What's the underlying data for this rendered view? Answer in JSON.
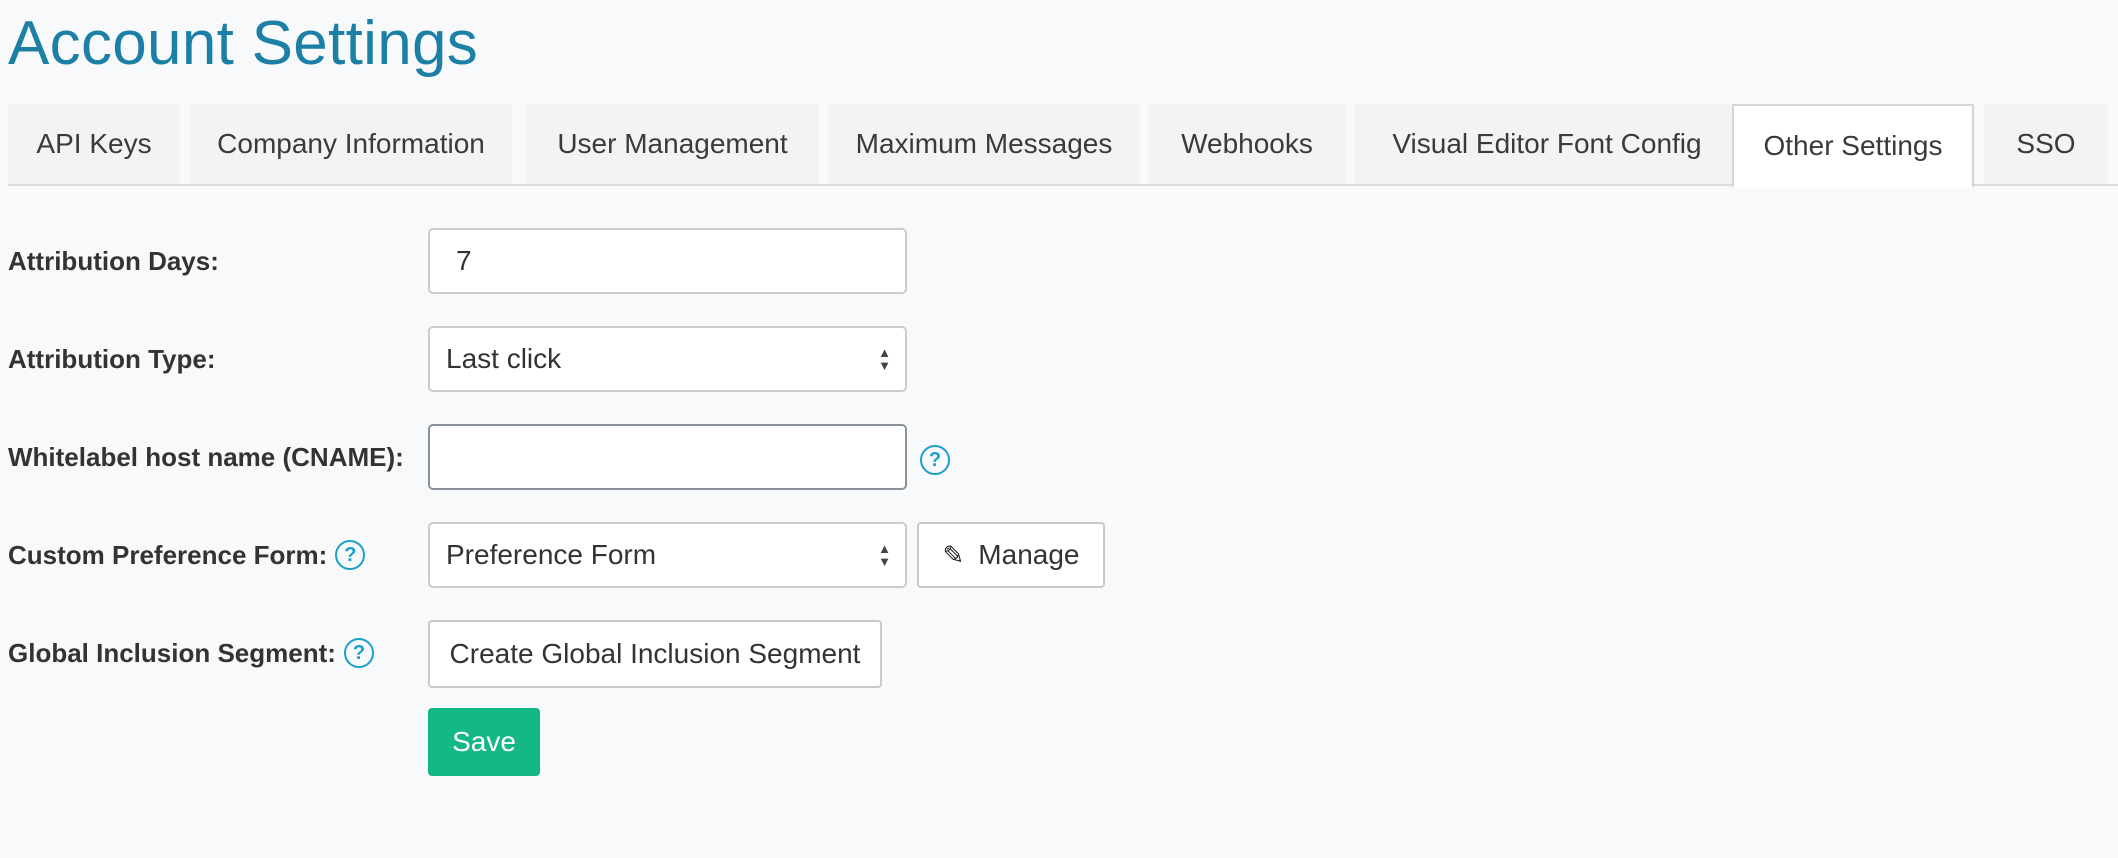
{
  "header": {
    "title": "Account Settings"
  },
  "tabs": [
    {
      "label": "API Keys",
      "active": false
    },
    {
      "label": "Company Information",
      "active": false
    },
    {
      "label": "User Management",
      "active": false
    },
    {
      "label": "Maximum Messages",
      "active": false
    },
    {
      "label": "Webhooks",
      "active": false
    },
    {
      "label": "Visual Editor Font Config",
      "active": false
    },
    {
      "label": "Other Settings",
      "active": true
    },
    {
      "label": "SSO",
      "active": false
    }
  ],
  "form": {
    "attribution_days": {
      "label": "Attribution Days:",
      "value": "7"
    },
    "attribution_type": {
      "label": "Attribution Type:",
      "selected": "Last click"
    },
    "whitelabel_host": {
      "label": "Whitelabel host name (CNAME):",
      "value": ""
    },
    "custom_preference_form": {
      "label": "Custom Preference Form:",
      "selected": "Preference Form",
      "manage_label": "Manage"
    },
    "global_inclusion_segment": {
      "label": "Global Inclusion Segment:",
      "button_label": "Create Global Inclusion Segment"
    },
    "save_label": "Save"
  },
  "icons": {
    "help": "help-circle-icon",
    "pencil": "pencil-icon",
    "select_arrows": "select-arrows-icon"
  },
  "colors": {
    "title": "#1c7fa6",
    "help_icon": "#1aa1c9",
    "save_button": "#14b886",
    "background": "#f8f9fb"
  }
}
